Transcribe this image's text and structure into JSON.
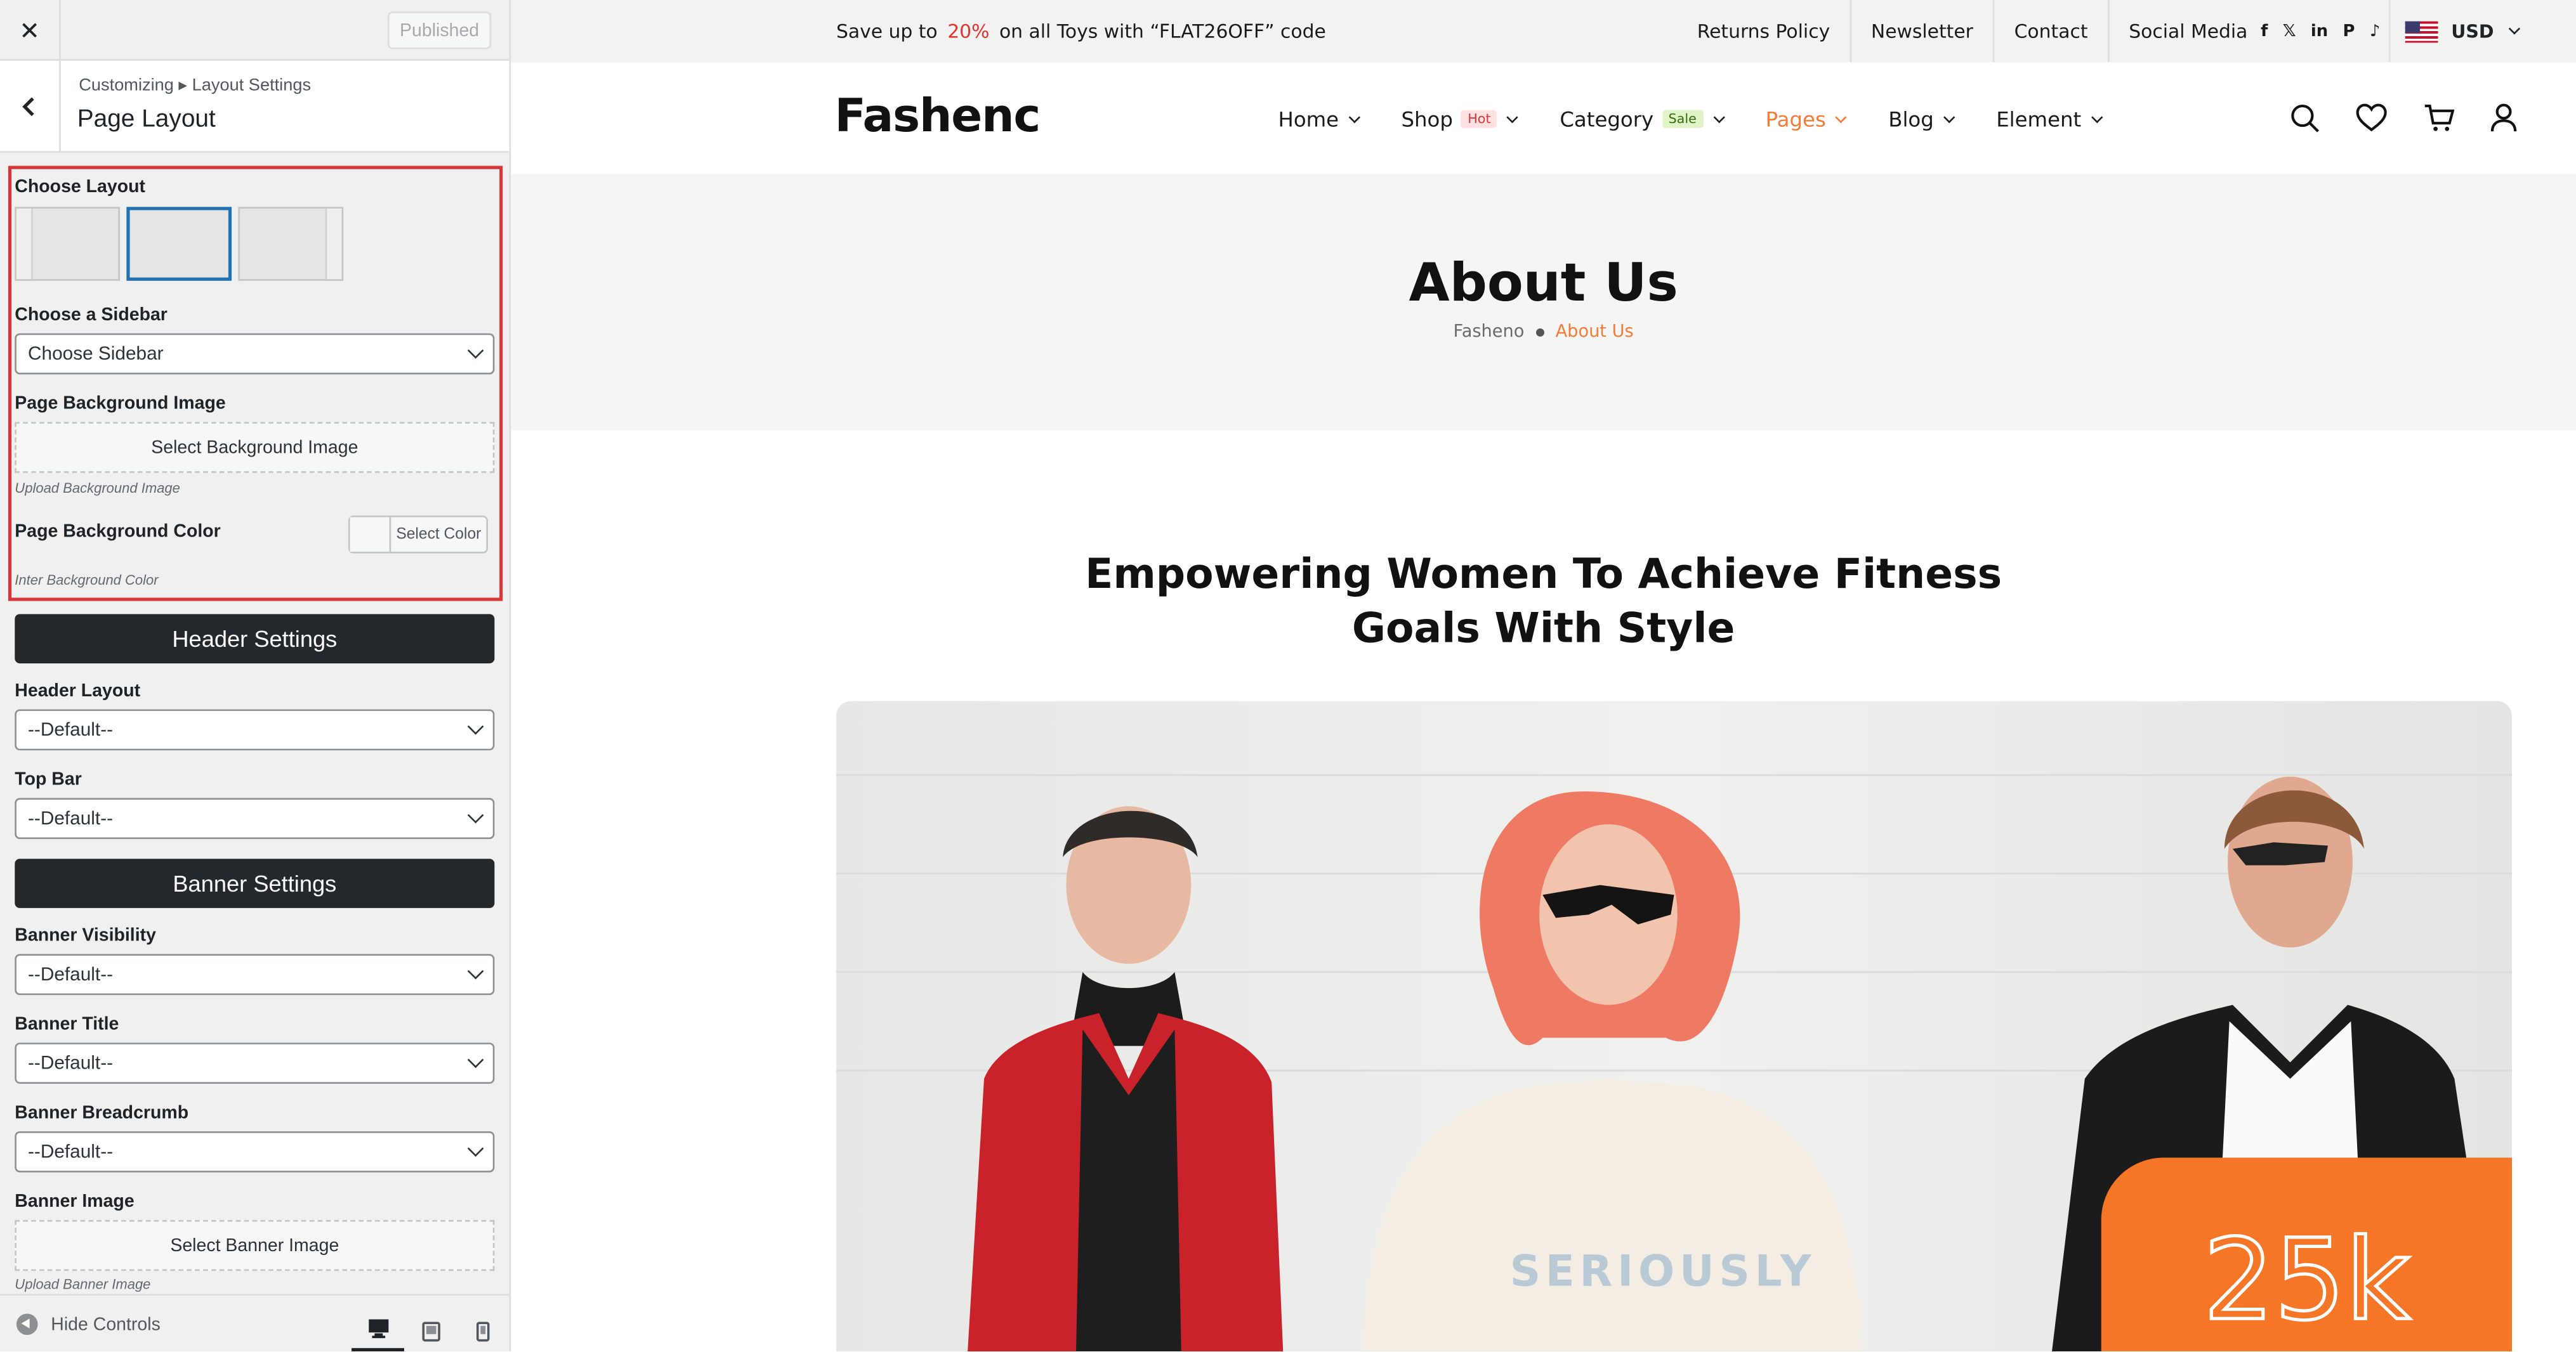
{
  "panel": {
    "close": "✕",
    "publish_label": "Published",
    "breadcrumb": "Customizing ▸ Layout Settings",
    "section_title": "Page Layout",
    "choose_layout_label": "Choose Layout",
    "selected_layout": 2,
    "sidebar_label": "Choose a Sidebar",
    "sidebar_value": "Choose Sidebar",
    "bg_image_label": "Page Background Image",
    "bg_image_button": "Select Background Image",
    "bg_image_note": "Upload Background Image",
    "bg_color_label": "Page Background Color",
    "bg_color_button": "Select Color",
    "bg_color_note": "Inter Background Color",
    "header_settings": "Header Settings",
    "header_layout_label": "Header Layout",
    "header_layout_value": "--Default--",
    "topbar_label": "Top Bar",
    "topbar_value": "--Default--",
    "banner_settings": "Banner Settings",
    "banner_visibility_label": "Banner Visibility",
    "banner_visibility_value": "--Default--",
    "banner_title_label": "Banner Title",
    "banner_title_value": "--Default--",
    "banner_breadcrumb_label": "Banner Breadcrumb",
    "banner_breadcrumb_value": "--Default--",
    "banner_image_label": "Banner Image",
    "banner_image_button": "Select Banner Image",
    "banner_image_note": "Upload Banner Image",
    "hide_controls": "Hide Controls"
  },
  "site": {
    "promo": {
      "before": "Save up to",
      "highlight": "20%",
      "after": "on all Toys with “FLAT26OFF” code"
    },
    "top_links": [
      "Returns Policy",
      "Newsletter",
      "Contact",
      "Social Media"
    ],
    "social_icons": [
      "f",
      "𝕏",
      "in",
      "P",
      "♪"
    ],
    "currency": "USD",
    "logo": "Fashenc",
    "menu": [
      {
        "label": "Home"
      },
      {
        "label": "Shop",
        "badge": "Hot"
      },
      {
        "label": "Category",
        "badge": "Sale"
      },
      {
        "label": "Pages"
      },
      {
        "label": "Blog"
      },
      {
        "label": "Element"
      }
    ],
    "banner_title": "About Us",
    "breadcrumb_home": "Fasheno",
    "breadcrumb_current": "About Us",
    "headline_line1": "Empowering Women To Achieve Fitness",
    "headline_line2": "Goals With Style",
    "photo_text": "SERIOUSLY",
    "stat": "25k",
    "colors": {
      "accent": "#f57c34",
      "promo_highlight": "#e2322d",
      "selection_box": "#d63638",
      "dark_bar": "#23282d"
    }
  }
}
